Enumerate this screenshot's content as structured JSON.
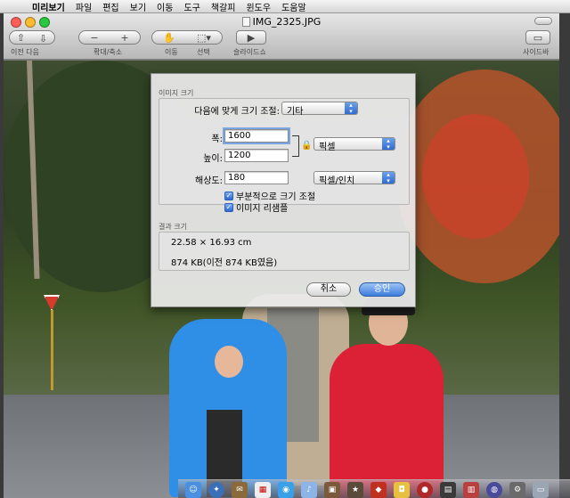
{
  "menubar": {
    "apple_icon": "apple-logo",
    "items": [
      "미리보기",
      "파일",
      "편집",
      "보기",
      "이동",
      "도구",
      "책갈피",
      "윈도우",
      "도움말"
    ]
  },
  "window": {
    "title": "IMG_2325.JPG",
    "toolbar": {
      "prev_next_label": "이전  다음",
      "zoom_label": "확대/축소",
      "move_label": "이동",
      "select_label": "선택",
      "slideshow_label": "슬라이드쇼",
      "sidebar_label": "사이드바"
    }
  },
  "dialog": {
    "section_image_size": "이미지 크기",
    "fit_label": "다음에 맞게 크기 조절:",
    "fit_value": "기타",
    "width_label": "폭:",
    "width_value": "1600",
    "height_label": "높이:",
    "height_value": "1200",
    "resolution_label": "해상도:",
    "resolution_value": "180",
    "unit_value": "픽셀",
    "resolution_unit_value": "픽셀/인치",
    "scale_proportionally": "부분적으로 크기 조절",
    "resample": "이미지 리샘플",
    "section_result": "결과 크기",
    "result_dimensions": "22.58 × 16.93 cm",
    "result_filesize": "874 KB(이전 874 KB였음)",
    "cancel_label": "취소",
    "ok_label": "승인"
  },
  "colors": {
    "accent": "#3c7ddc",
    "close": "#ff5f57",
    "minimize": "#febc2e",
    "zoom": "#28c840"
  }
}
